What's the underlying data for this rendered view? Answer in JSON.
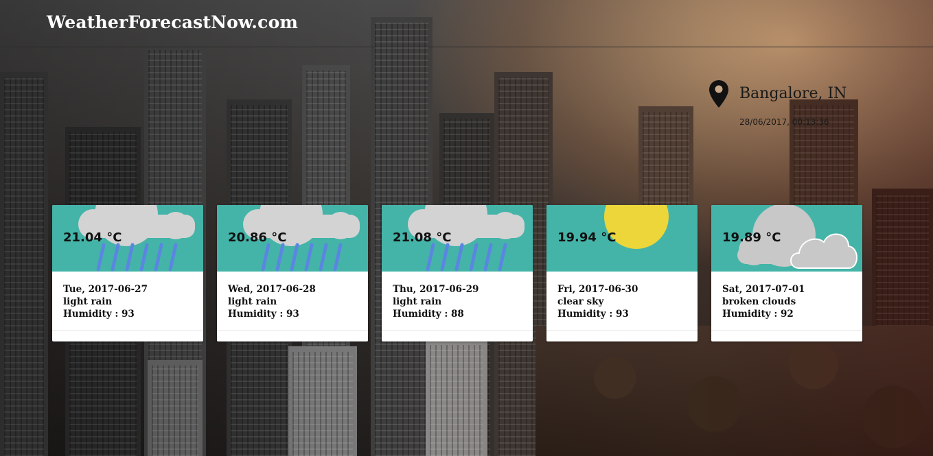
{
  "header": {
    "site_title": "WeatherForecastNow.com"
  },
  "location": {
    "icon": "map-pin-icon",
    "city": "Bangalore, IN",
    "datetime": "28/06/2017, 00:13:36"
  },
  "colors": {
    "card_visual_bg": "#44b4a8",
    "cloud": "#d3d3d3",
    "rain": "#5b86e0",
    "sun": "#ecd63a"
  },
  "forecast": [
    {
      "temp": "21.04 °C",
      "date": "Tue, 2017-06-27",
      "description": "light rain",
      "humidity": "Humidity : 93",
      "icon": "rain-icon"
    },
    {
      "temp": "20.86 °C",
      "date": "Wed, 2017-06-28",
      "description": "light rain",
      "humidity": "Humidity : 93",
      "icon": "rain-icon"
    },
    {
      "temp": "21.08 °C",
      "date": "Thu, 2017-06-29",
      "description": "light rain",
      "humidity": "Humidity : 88",
      "icon": "rain-icon"
    },
    {
      "temp": "19.94 °C",
      "date": "Fri, 2017-06-30",
      "description": "clear sky",
      "humidity": "Humidity : 93",
      "icon": "sun-icon"
    },
    {
      "temp": "19.89 °C",
      "date": "Sat, 2017-07-01",
      "description": "broken clouds",
      "humidity": "Humidity : 92",
      "icon": "broken-clouds-icon"
    }
  ]
}
